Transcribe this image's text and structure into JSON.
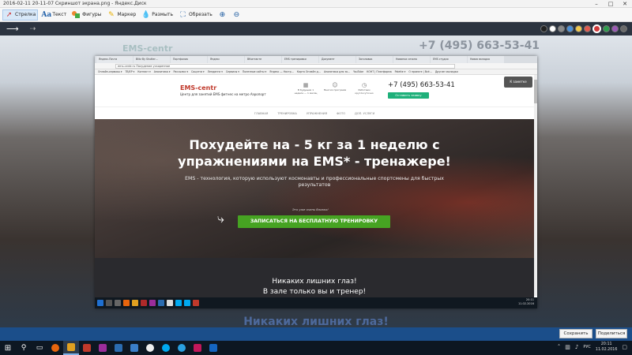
{
  "window": {
    "title": "2016-02-11 20-11-07 Скриншот экрана.png - Яндекс.Диск",
    "controls": [
      "–",
      "□",
      "✕"
    ]
  },
  "toolbar": {
    "tools": [
      {
        "label": "Стрелка",
        "icon": "arrow-icon"
      },
      {
        "label": "Текст",
        "icon": "text-icon"
      },
      {
        "label": "Фигуры",
        "icon": "shapes-icon"
      },
      {
        "label": "Маркер",
        "icon": "marker-icon"
      },
      {
        "label": "Размыть",
        "icon": "blur-icon"
      },
      {
        "label": "Обрезать",
        "icon": "crop-icon"
      }
    ],
    "zoom_in": "+",
    "zoom_out": "−"
  },
  "palette": [
    "#222222",
    "#ffffff",
    "#8a8a8a",
    "#4a90d9",
    "#f2c94c",
    "#e05a4f",
    "#d13b3b",
    "#2e9e4e",
    "#9b59b6",
    "#6a6a6a"
  ],
  "canvas": {
    "bg_phone": "+7 (495) 663-53-41",
    "bg_brand": "EMS-centr",
    "bg_bottom": "Никаких лишних глаз!"
  },
  "inner_browser": {
    "tabs": [
      "Яндекс.Почта",
      "Blitz By Shutter…",
      "Портфолио",
      "Яндекс",
      "ВКонтакте",
      "EMS тренировки",
      "Документ",
      "Заголовок",
      "Новинки сезона",
      "EMS студия",
      "Новая вкладка"
    ],
    "url": "ems-centr.ru   Похудение ускоренное",
    "bookmarks": [
      "Онлайн-сервисы ▾",
      "ТВ/ЕР ▾",
      "Контакт ▾",
      "Аналитика ▾",
      "Рассылки ▾",
      "Соцсети ▾",
      "Лендинги ▾",
      "Сервисы ▾",
      "Полезные сайты ▾",
      "Яндекс — Настр…",
      "Карта Онлайн д…",
      "Аналитика для за…",
      "YouTube",
      "КОНТ | Платформа",
      "Palette ▾",
      "О проекте | Всё…",
      "Другие закладки"
    ]
  },
  "site": {
    "brand": "EMS-centr",
    "tagline": "Центр для занятий EMS фитнес на метро Аэропорт",
    "features": [
      {
        "text": "В будущем 1 неделе — 1 месяц",
        "icon": "calendar-icon"
      },
      {
        "text": "Многих программ",
        "icon": "people-icon"
      },
      {
        "text": "Работаем круглосуточно",
        "icon": "clock-icon"
      }
    ],
    "phone": "+7 (495) 663-53-41",
    "callback": "Оставить заявку",
    "corner_btn": "К заметке",
    "nav": [
      "ГЛАВНАЯ",
      "ТРЕНИРОВКА",
      "УПРАЖНЕНИЯ",
      "ФОТО",
      "ДОП. УСЛУГИ"
    ],
    "hero_title_line1": "Похудейте на - 5 кг за 1 неделю с",
    "hero_title_line2": "упражнениями на EMS* - тренажере!",
    "hero_sub": "EMS - технология, которую используют космонавты и профессиональные спортсмены для быстрых результатов",
    "hero_note": "Это уже очень близко!",
    "cta": "ЗАПИСАТЬСЯ НА БЕСПЛАТНУЮ ТРЕНИРОВКУ",
    "dark_line1": "Никаких лишних глаз!",
    "dark_line2": "В зале только вы и тренер!"
  },
  "inner_taskbar": {
    "clock_time": "20:11",
    "clock_date": "11.02.2016"
  },
  "actions": {
    "save": "Сохранить",
    "share": "Поделиться"
  },
  "taskbar": {
    "lang": "РУС",
    "time": "20:11",
    "date": "11.02.2016"
  }
}
